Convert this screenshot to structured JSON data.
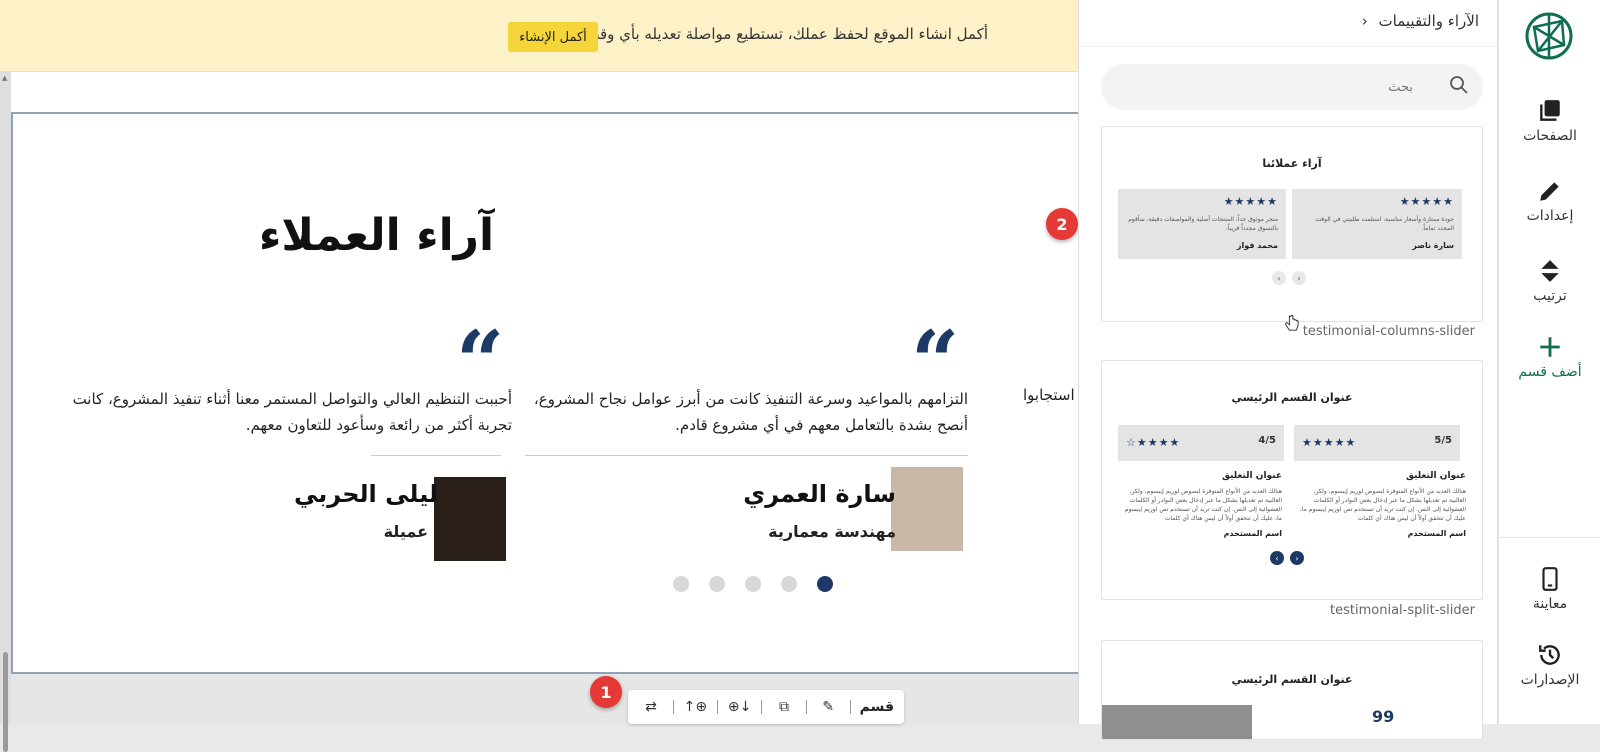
{
  "banner": {
    "message": "أكمل انشاء الموقع لحفظ عملك، تستطيع مواصلة تعديله بأي وقت",
    "button_label": "أكمل الإنشاء"
  },
  "section": {
    "title": "آراء العملاء",
    "partial_text": "استجابوا",
    "testimonials": [
      {
        "text": "التزامهم بالمواعيد وسرعة التنفيذ كانت من أبرز عوامل نجاح المشروع، أنصح بشدة بالتعامل معهم في أي مشروع قادم.",
        "name": "سارة العمري",
        "role": "مهندسة معمارية"
      },
      {
        "text": "أحببت التنظيم العالي والتواصل المستمر معنا أثناء تنفيذ المشروع، كانت تجربة أكثر من رائعة وسأعود للتعاون معهم.",
        "name": "ليلى الحربي",
        "role": "عميلة"
      }
    ],
    "dots_count": 5,
    "active_dot": 0
  },
  "toolbar": {
    "label": "قسم",
    "edit_icon": "pencil-icon",
    "copy_icon": "copy-icon",
    "add_below_icon": "add-below-icon",
    "add_above_icon": "add-above-icon",
    "swap_icon": "swap-icon"
  },
  "markers": [
    "1",
    "2"
  ],
  "panel": {
    "header": "الآراء والتقييمات",
    "search_placeholder": "بحث",
    "cards": [
      {
        "label": "testimonial-columns-slider",
        "title": "آراء عملائنا",
        "boxes": [
          {
            "stars": "★★★★★",
            "text": "جودة ممتازة وأسعار مناسبة، استلمت طلبيتي في الوقت المحدد تماماً.",
            "name": "سارة ناصر"
          },
          {
            "stars": "★★★★★",
            "text": "متجر موثوق جداً، المنتجات أصلية والمواصفات دقيقة، سأقوم بالتسوق مجدداً قريباً.",
            "name": "محمد فواز"
          }
        ]
      },
      {
        "label": "testimonial-split-slider",
        "title": "عنوان القسم الرئيسي",
        "boxes": [
          {
            "stars": "★★★★★",
            "rating": "5/5",
            "heading": "عنوان التعليق",
            "text": "هنالك العديد من الأنواع المتوفرة لنصوص لوريم إيبسوم، ولكن الغالبية تم تعديلها بشكل ما عبر إدخال بعض النوادر أو الكلمات العشوائية إلى النص. إن كنت تريد أن تستخدم نص لوريم إيبسوم ما، عليك أن تتحقق أولاً أن ليس هناك أي كلمات",
            "name": "اسم المستخدم"
          },
          {
            "stars": "★★★★☆",
            "rating": "4/5",
            "heading": "عنوان التعليق",
            "text": "هنالك العديد من الأنواع المتوفرة لنصوص لوريم إيبسوم، ولكن الغالبية تم تعديلها بشكل ما عبر إدخال بعض النوادر أو الكلمات العشوائية إلى النص. إن كنت تريد أن تستخدم نص لوريم إيبسوم ما، عليك أن تتحقق أولاً أن ليس هناك أي كلمات",
            "name": "اسم المستخدم"
          }
        ]
      },
      {
        "label": "",
        "title": "عنوان القسم الرئيسي",
        "quote": "99"
      }
    ]
  },
  "nav": {
    "items": [
      {
        "label": "الصفحات",
        "icon": "pages-icon"
      },
      {
        "label": "إعدادات",
        "icon": "pencil-icon"
      },
      {
        "label": "ترتيب",
        "icon": "sort-icon"
      },
      {
        "label": "أضف قسم",
        "icon": "plus-icon"
      },
      {
        "label": "معاينة",
        "icon": "mobile-icon"
      },
      {
        "label": "الإصدارات",
        "icon": "history-icon"
      }
    ],
    "accent": "#0f6e4f"
  }
}
